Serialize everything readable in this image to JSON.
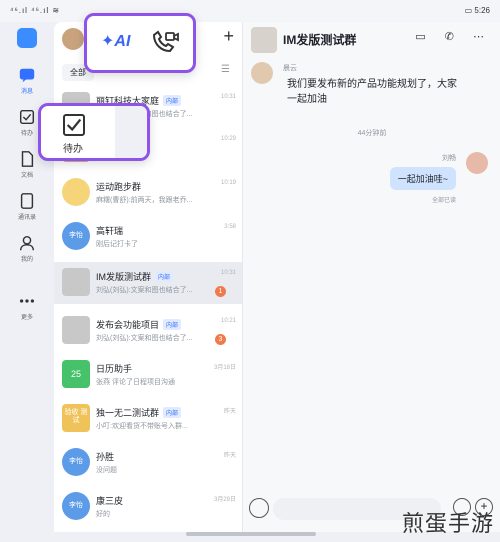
{
  "status_bar": {
    "left": "⁴⁶.ıl ⁴⁶.ıl ≋",
    "right": "▭ 5:26"
  },
  "rail": {
    "items": [
      {
        "label": "消息",
        "icon": "message-icon",
        "active": true
      },
      {
        "label": "待办",
        "icon": "todo-icon"
      },
      {
        "label": "文档",
        "icon": "doc-icon"
      },
      {
        "label": "通讯录",
        "icon": "contacts-icon"
      },
      {
        "label": "我的",
        "icon": "user-icon"
      },
      {
        "label": "更多",
        "icon": "more-icon"
      }
    ]
  },
  "list": {
    "filter_all": "全部",
    "rows": [
      {
        "name": "丽钉科技大家庭",
        "tag": "内部",
        "preview": "刘弘(刘弘):文案和图也结合了...",
        "time": "10:31",
        "color": "#c8c8c8"
      },
      {
        "name": "刘弘",
        "preview": "现在在线吗",
        "time": "10:29",
        "color": "#d4b08c"
      },
      {
        "name": "运动跑步群",
        "preview": "麻糬(曹舒):前两天，我跟老乔...",
        "time": "10:19",
        "color": "#f6d47a"
      },
      {
        "name": "高轩瑞",
        "tag": "",
        "preview": "刚后记打卡了",
        "time": "3:58",
        "color": "#5b9be8",
        "avatar_text": "李怡"
      },
      {
        "name": "IM发版测试群",
        "tag": "内部",
        "preview": "刘弘(刘弘):文案和图也结合了...",
        "time": "10:31",
        "badge": "1",
        "selected": true,
        "color": "#c8c8c8"
      },
      {
        "name": "发布会功能项目",
        "tag": "内部",
        "preview": "刘弘(刘弘):文案和图也结合了...",
        "time": "10:21",
        "badge": "3",
        "color": "#c8c8c8"
      },
      {
        "name": "日历助手",
        "preview": "张燕 评论了日程项目沟通",
        "time": "3月18日",
        "color": "#45c26a",
        "avatar_text": "25"
      },
      {
        "name": "独一无二测试群",
        "tag": "内部",
        "preview": "小叮:欢迎看货不带账号入群...",
        "time": "昨天",
        "color": "#f0c35a",
        "avatar_text": "验收 测试"
      },
      {
        "name": "孙胜",
        "preview": "没问题",
        "time": "昨天",
        "color": "#5b9be8",
        "avatar_text": "李怡"
      },
      {
        "name": "康三皮",
        "preview": "好的",
        "time": "3月29日",
        "color": "#5b9be8",
        "avatar_text": "李怡"
      }
    ]
  },
  "chat": {
    "title": "IM发版测试群",
    "sender": "晨云",
    "message": "我们要发布新的产品功能规划了，大家一起加油",
    "time_separator": "44分钟前",
    "me_name": "刘畅",
    "me_message": "一起加油哇~",
    "me_read": "全部已读"
  },
  "popups": {
    "ai_label": "AI",
    "todo_label": "待办"
  },
  "watermark": "煎蛋手游",
  "colors": {
    "accent": "#3370ff",
    "highlight_border": "#8e54e9"
  }
}
